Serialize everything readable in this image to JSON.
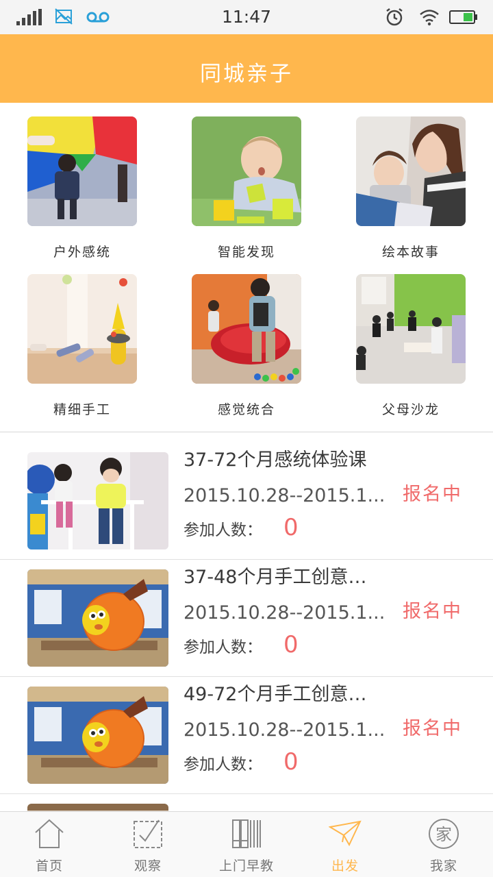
{
  "status_bar": {
    "time": "11:47"
  },
  "header": {
    "title": "同城亲子"
  },
  "categories": [
    {
      "label": "户外感统",
      "icon": "outdoor-sensory-photo"
    },
    {
      "label": "智能发现",
      "icon": "baby-blocks-photo"
    },
    {
      "label": "绘本故事",
      "icon": "picture-book-photo"
    },
    {
      "label": "精细手工",
      "icon": "handcraft-photo"
    },
    {
      "label": "感觉统合",
      "icon": "sensory-tunnel-photo"
    },
    {
      "label": "父母沙龙",
      "icon": "parent-salon-photo"
    }
  ],
  "courses": [
    {
      "title": "37-72个月感统体验课",
      "date": "2015.10.28--2015.1...",
      "status": "报名中",
      "people_label": "参加人数：",
      "count": "0"
    },
    {
      "title": "37-48个月手工创意…",
      "date": "2015.10.28--2015.1...",
      "status": "报名中",
      "people_label": "参加人数：",
      "count": "0"
    },
    {
      "title": "49-72个月手工创意…",
      "date": "2015.10.28--2015.1...",
      "status": "报名中",
      "people_label": "参加人数：",
      "count": "0"
    }
  ],
  "tabs": [
    {
      "label": "首页",
      "icon": "home-icon"
    },
    {
      "label": "观察",
      "icon": "checkbox-icon"
    },
    {
      "label": "上门早教",
      "icon": "books-icon"
    },
    {
      "label": "出发",
      "icon": "paper-plane-icon",
      "active": true
    },
    {
      "label": "我家",
      "icon": "family-icon"
    }
  ],
  "colors": {
    "accent": "#ffb74d",
    "status": "#f06a6a",
    "text": "#333333"
  }
}
